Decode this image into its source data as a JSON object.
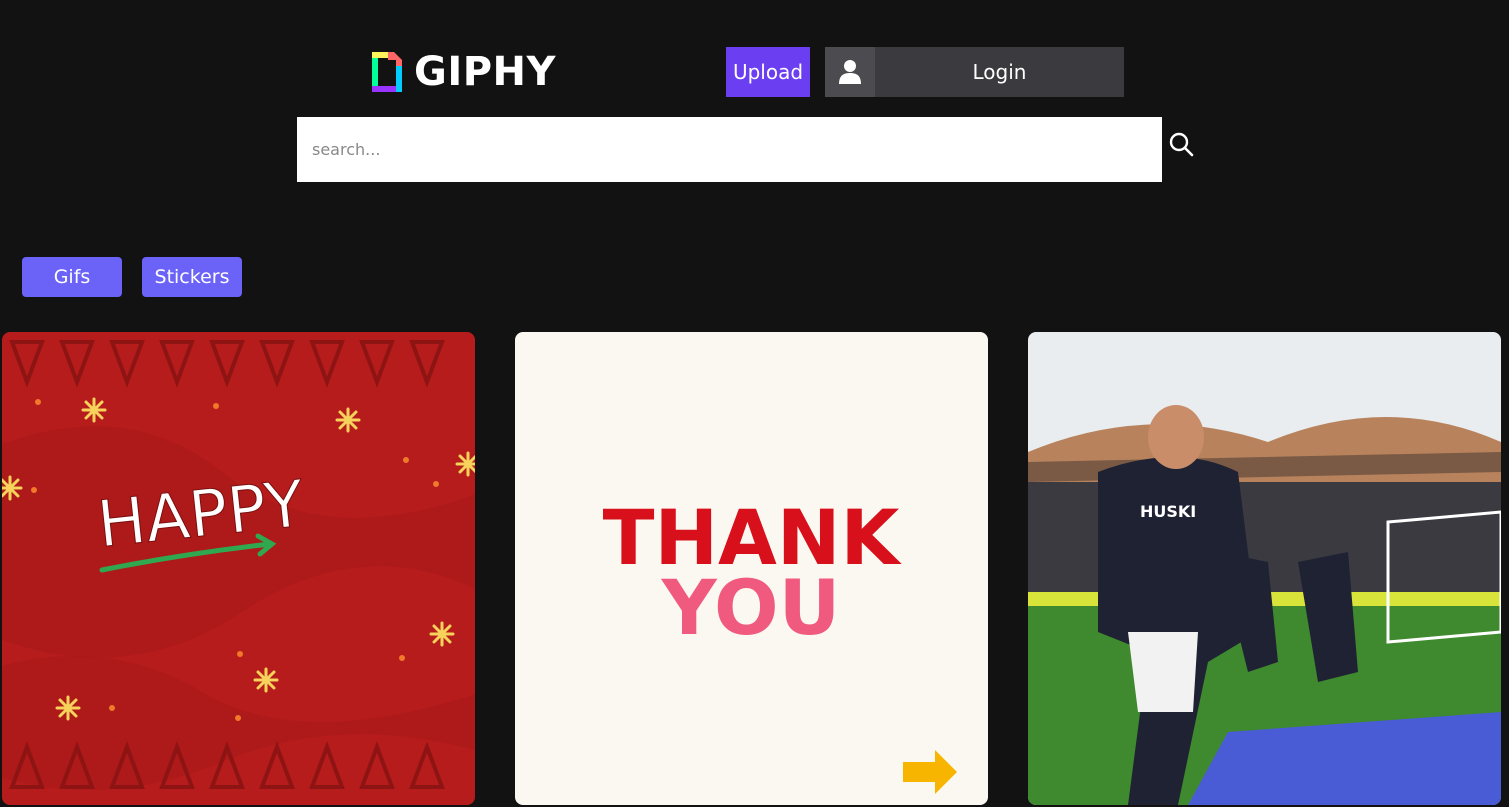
{
  "header": {
    "logo_text": "GIPHY",
    "upload_label": "Upload",
    "login_label": "Login"
  },
  "search": {
    "placeholder": "search..."
  },
  "filters": {
    "gifs_label": "Gifs",
    "stickers_label": "Stickers"
  },
  "grid": {
    "cards": [
      {
        "text": "HAPPY",
        "bg": "#b71c1c"
      },
      {
        "text_line1": "THANK",
        "text_line2": "YOU",
        "bg": "#fbf8f1"
      },
      {
        "subject": "soccer-celebration",
        "shirt_text": "HUSKI"
      }
    ]
  },
  "colors": {
    "background": "#121212",
    "upload": "#6b3ef2",
    "filter": "#6b62f7",
    "login": "#3b3b3f"
  }
}
